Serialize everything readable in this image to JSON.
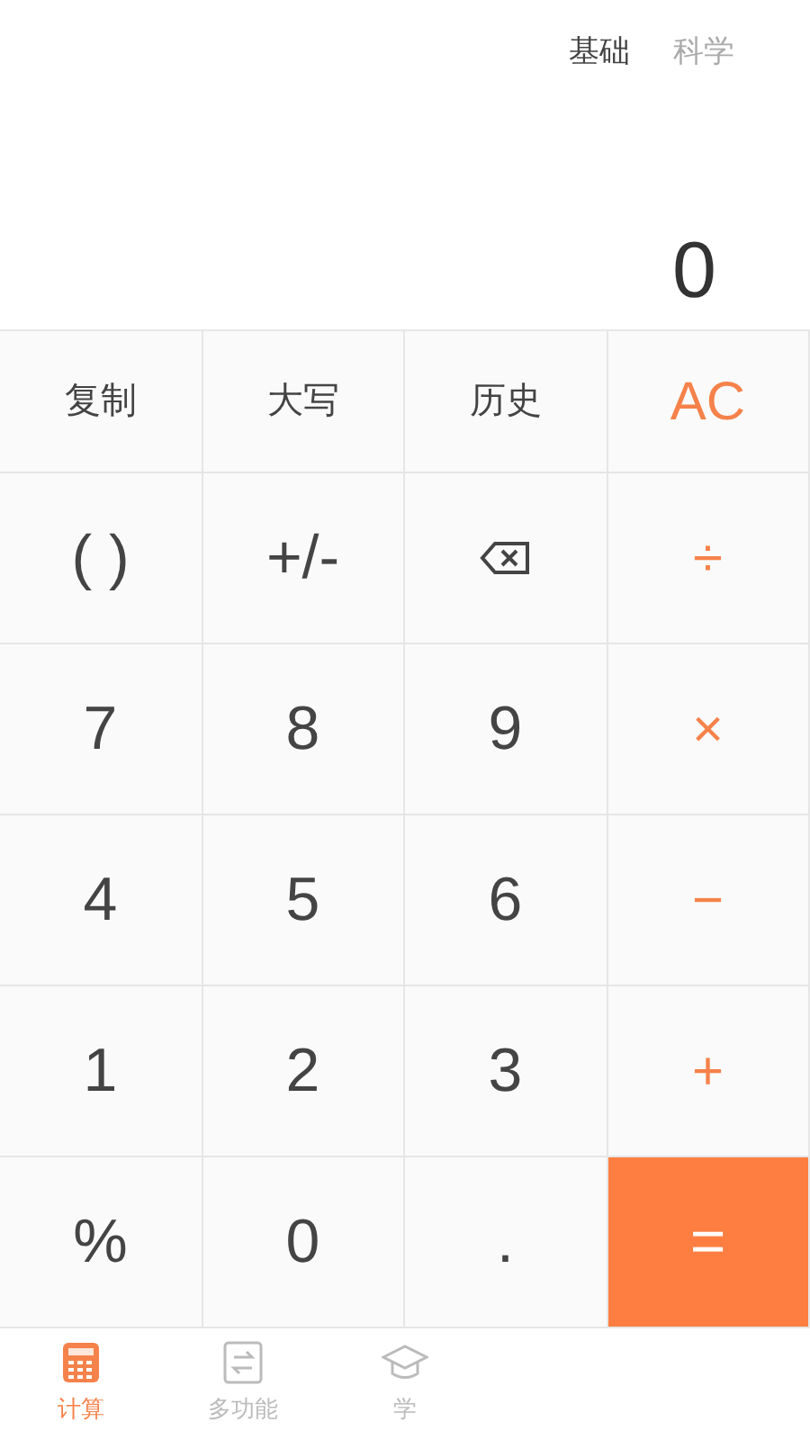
{
  "modes": [
    {
      "label": "基础",
      "selected": true
    },
    {
      "label": "科学",
      "selected": false
    }
  ],
  "display": {
    "value": "0"
  },
  "function_keys": [
    {
      "label": "复制",
      "kind": "text"
    },
    {
      "label": "大写",
      "kind": "text"
    },
    {
      "label": "历史",
      "kind": "text"
    },
    {
      "label": "AC",
      "kind": "op"
    }
  ],
  "keys": [
    {
      "label": "( )",
      "kind": "text"
    },
    {
      "label": "+/-",
      "kind": "text"
    },
    {
      "kind": "backspace"
    },
    {
      "label": "÷",
      "kind": "op"
    },
    {
      "label": "7",
      "kind": "text"
    },
    {
      "label": "8",
      "kind": "text"
    },
    {
      "label": "9",
      "kind": "text"
    },
    {
      "label": "×",
      "kind": "op"
    },
    {
      "label": "4",
      "kind": "text"
    },
    {
      "label": "5",
      "kind": "text"
    },
    {
      "label": "6",
      "kind": "text"
    },
    {
      "label": "−",
      "kind": "op"
    },
    {
      "label": "1",
      "kind": "text"
    },
    {
      "label": "2",
      "kind": "text"
    },
    {
      "label": "3",
      "kind": "text"
    },
    {
      "label": "+",
      "kind": "op"
    },
    {
      "label": "%",
      "kind": "text"
    },
    {
      "label": "0",
      "kind": "text"
    },
    {
      "label": ".",
      "kind": "text"
    },
    {
      "label": "=",
      "kind": "equals"
    }
  ],
  "tabs": [
    {
      "label": "计算",
      "selected": true
    },
    {
      "label": "多功能",
      "selected": false
    },
    {
      "label": "学",
      "selected": false
    }
  ]
}
